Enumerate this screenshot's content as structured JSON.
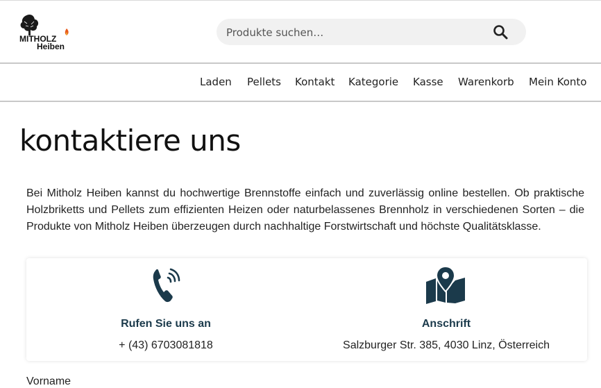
{
  "logo": {
    "line1": "MITHOLZ",
    "line2": "Heiben"
  },
  "search": {
    "placeholder": "Produkte suchen…"
  },
  "nav": [
    "Laden",
    "Pellets",
    "Kontakt",
    "Kategorie",
    "Kasse",
    "Warenkorb",
    "Mein Konto"
  ],
  "page": {
    "title": "kontaktiere uns",
    "intro": "Bei Mitholz Heiben kannst du hochwertige Brennstoffe einfach und zuverlässig online bestellen. Ob praktische Holzbriketts und Pellets zum effizienten Heizen oder naturbelassenes Brennholz in verschiedenen Sorten – die Produkte von Mitholz Heiben überzeugen durch nachhaltige Forstwirtschaft und höchste Qualitätsklasse."
  },
  "contact": {
    "phone": {
      "heading": "Rufen Sie uns an",
      "value": "+ (43) 6703081818",
      "icon": "phone-ringing-icon"
    },
    "address": {
      "heading": "Anschrift",
      "value": "Salzburger Str. 385, 4030 Linz, Österreich",
      "icon": "map-location-icon"
    }
  },
  "form": {
    "first_name_label": "Vorname"
  },
  "colors": {
    "accent": "#1b3a4b",
    "flame": "#e85a1b"
  }
}
